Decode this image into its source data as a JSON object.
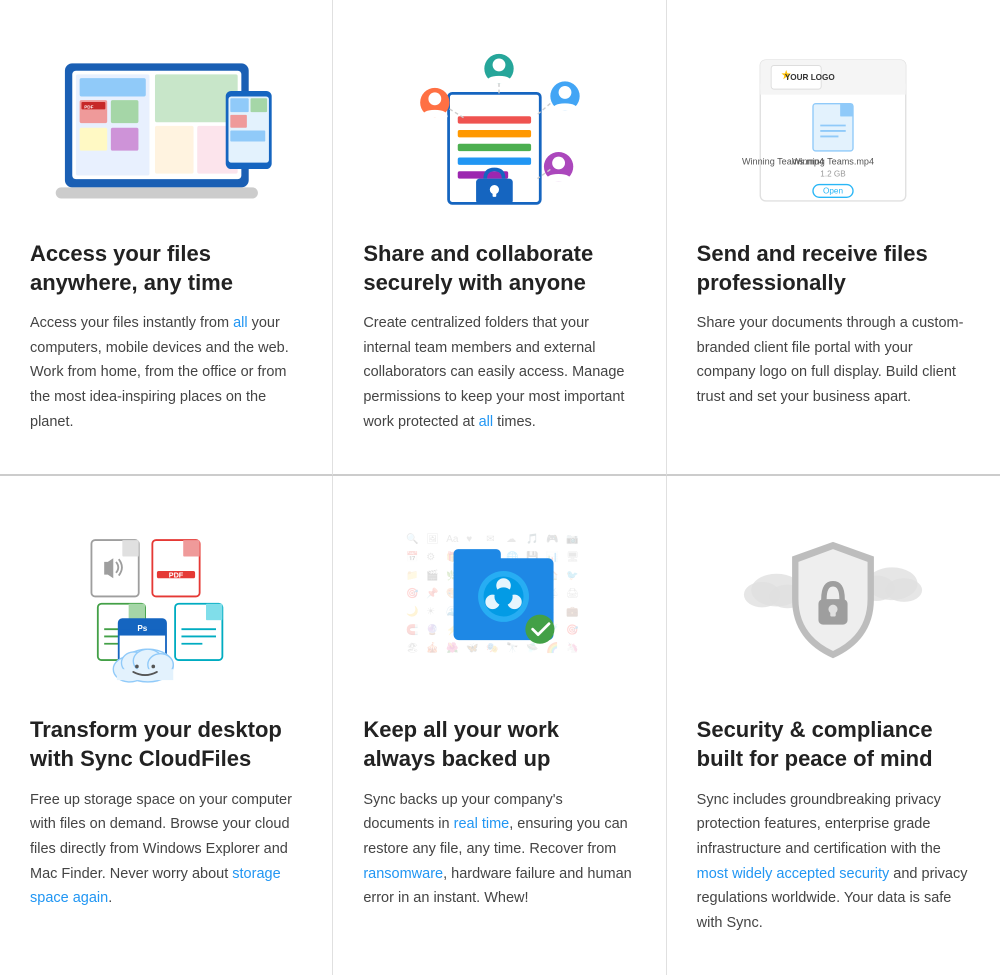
{
  "cells": [
    {
      "id": "access-files",
      "title": "Access your files anywhere, any time",
      "description": "Access your files instantly from {all} your computers, mobile devices and the web. Work from home, from the office or from the most idea-inspiring places on the planet.",
      "highlights": [
        "all"
      ],
      "row": "top"
    },
    {
      "id": "share-collab",
      "title": "Share and collaborate securely with anyone",
      "description": "Create centralized folders that your internal team members and external collaborators can easily access. Manage permissions to keep your most important work protected at {all} times.",
      "highlights": [
        "all"
      ],
      "row": "top"
    },
    {
      "id": "send-receive",
      "title": "Send and receive files professionally",
      "description": "Share your documents through a custom-branded client file portal with your company logo on full display. Build client trust and set your business apart.",
      "highlights": [],
      "row": "top"
    },
    {
      "id": "transform-desktop",
      "title": "Transform your desktop with Sync CloudFiles",
      "description": "Free up storage space on your computer with files on demand. Browse your cloud files directly from Windows Explorer and Mac Finder. Never worry about {storage space again}.",
      "highlights": [
        "storage space again"
      ],
      "row": "bottom"
    },
    {
      "id": "keep-work",
      "title": "Keep all your work always backed up",
      "description": "Sync backs up your company's documents in {real time}, ensuring you can restore any file, any time. Recover from {ransomware}, hardware failure and human error in an instant. Whew!",
      "highlights": [
        "real time",
        "ransomware"
      ],
      "row": "bottom"
    },
    {
      "id": "security",
      "title": "Security & compliance built for peace of mind",
      "description": "Sync includes groundbreaking privacy protection features, enterprise grade infrastructure and certification with the {most widely accepted security} and privacy regulations worldwide. Your data is safe with Sync.",
      "highlights": [
        "most widely accepted security"
      ],
      "row": "bottom"
    }
  ]
}
